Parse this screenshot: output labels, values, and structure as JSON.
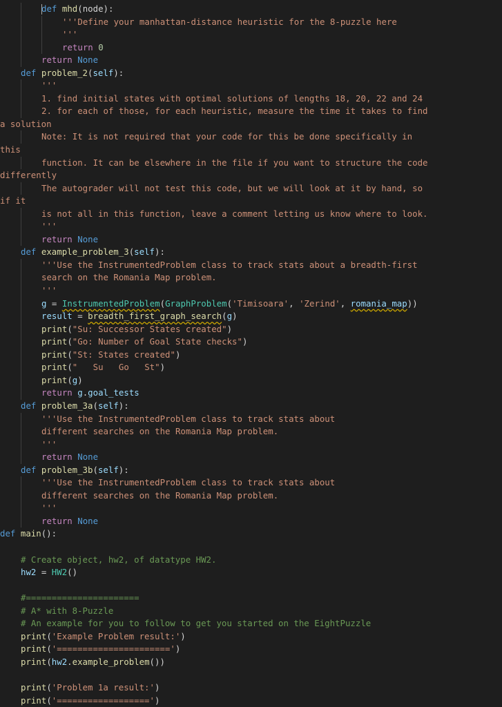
{
  "code": {
    "l01_def": "def",
    "l01_name": "mhd",
    "l01_args": "(node):",
    "l02": "'''Define your manhattan-distance heuristic for the 8-puzzle here",
    "l03": "'''",
    "l04_ret": "return",
    "l04_val": "0",
    "l05_ret": "return",
    "l05_val": "None",
    "l06_def": "def",
    "l06_name": "problem_2",
    "l06_self": "self",
    "l07": "'''",
    "l08": "1. find initial states with optimal solutions of lengths 18, 20, 22 and 24",
    "l09": "2. for each of those, for each heuristic, measure the time it takes to find",
    "l10": "a solution",
    "l11": "Note: It is not required that your code for this be done specifically in",
    "l12": "this",
    "l13": "function. It can be elsewhere in the file if you want to structure the code",
    "l14": "differently",
    "l15": "The autograder will not test this code, but we will look at it by hand, so",
    "l16": "if it",
    "l17": "is not all in this function, leave a comment letting us know where to look.",
    "l18": "'''",
    "l19_ret": "return",
    "l19_val": "None",
    "l20_def": "def",
    "l20_name": "example_problem_3",
    "l20_self": "self",
    "l21": "'''Use the InstrumentedProblem class to track stats about a breadth-first",
    "l22": "search on the Romania Map problem.",
    "l23": "'''",
    "l24_var": "g",
    "l24_cls1": "InstrumentedProblem",
    "l24_cls2": "GraphProblem",
    "l24_str1": "'Timisoara'",
    "l24_str2": "'Zerind'",
    "l24_arg": "romania_map",
    "l25_var": "result",
    "l25_fn": "breadth_first_graph_search",
    "l25_arg": "g",
    "l26_fn": "print",
    "l26_str": "\"Su: Successor States created\"",
    "l27_fn": "print",
    "l27_str": "\"Go: Number of Goal State checks\"",
    "l28_fn": "print",
    "l28_str": "\"St: States created\"",
    "l29_fn": "print",
    "l29_str": "\"   Su   Go   St\"",
    "l30_fn": "print",
    "l30_arg": "g",
    "l31_ret": "return",
    "l31_obj": "g",
    "l31_attr": "goal_tests",
    "l32_def": "def",
    "l32_name": "problem_3a",
    "l32_self": "self",
    "l33": "'''Use the InstrumentedProblem class to track stats about",
    "l34": "different searches on the Romania Map problem.",
    "l35": "'''",
    "l36_ret": "return",
    "l36_val": "None",
    "l37_def": "def",
    "l37_name": "problem_3b",
    "l37_self": "self",
    "l38": "'''Use the InstrumentedProblem class to track stats about",
    "l39": "different searches on the Romania Map problem.",
    "l40": "'''",
    "l41_ret": "return",
    "l41_val": "None",
    "l42_def": "def",
    "l42_name": "main",
    "l44": "# Create object, hw2, of datatype HW2.",
    "l45_var": "hw2",
    "l45_cls": "HW2",
    "l47": "#======================",
    "l48": "# A* with 8-Puzzle",
    "l49": "# An example for you to follow to get you started on the EightPuzzle",
    "l50_fn": "print",
    "l50_str": "'Example Problem result:'",
    "l51_fn": "print",
    "l51_str": "'======================'",
    "l52_fn1": "print",
    "l52_obj": "hw2",
    "l52_fn2": "example_problem",
    "l54_fn": "print",
    "l54_str": "'Problem 1a result:'",
    "l55_fn": "print",
    "l55_str": "'=================='"
  }
}
